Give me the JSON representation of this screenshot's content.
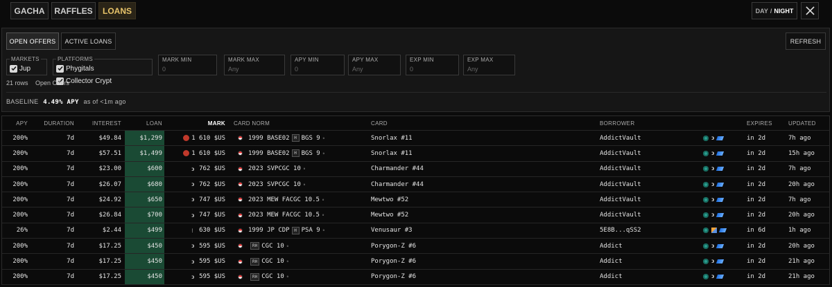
{
  "nav": {
    "tabs": [
      {
        "label": "GACHA",
        "active": false
      },
      {
        "label": "RAFFLES",
        "active": false
      },
      {
        "label": "LOANS",
        "active": true
      }
    ],
    "theme_day": "DAY",
    "theme_sep": "/",
    "theme_night": "NIGHT",
    "x_icon": "x-logo-icon"
  },
  "filters": {
    "view_tabs": [
      {
        "label": "OPEN OFFERS",
        "selected": true
      },
      {
        "label": "ACTIVE LOANS",
        "selected": false
      }
    ],
    "refresh_label": "REFRESH",
    "markets": {
      "legend": "MARKETS",
      "options": [
        {
          "label": "Jup",
          "checked": true
        }
      ]
    },
    "platforms": {
      "legend": "PLATFORMS",
      "options": [
        {
          "label": "Phygitals",
          "checked": true
        },
        {
          "label": "Collector Crypt",
          "checked": true
        }
      ]
    },
    "inputs": [
      {
        "label": "MARK MIN",
        "placeholder": "0"
      },
      {
        "label": "MARK MAX",
        "placeholder": "Any"
      },
      {
        "label": "APY MIN",
        "placeholder": "0"
      },
      {
        "label": "APY MAX",
        "placeholder": "Any"
      },
      {
        "label": "EXP MIN",
        "placeholder": "0"
      },
      {
        "label": "EXP MAX",
        "placeholder": "Any"
      }
    ],
    "rows_count": "21 rows",
    "scope": "Open Offers",
    "baseline_label": "BASELINE",
    "baseline_value": "4.49% APY",
    "baseline_asof": "as of <1m ago"
  },
  "table": {
    "headers": {
      "apy": "APY",
      "duration": "DURATION",
      "interest": "INTEREST",
      "loan": "LOAN",
      "mark": "MARK",
      "card_norm": "CARD NORM",
      "card": "CARD",
      "borrower": "BORROWER",
      "expires": "EXPIRES",
      "updated": "UPDATED"
    },
    "accent_loan_bg": "#1a4a34",
    "rows": [
      {
        "apy": "200%",
        "duration": "7d",
        "interest": "$49.84",
        "loan": "$1,299",
        "mark_icon": "red-coin-icon",
        "mark": "1 610 $US",
        "year_set": "1999 BASE02",
        "grade_badge": "H",
        "grade": "BGS 9",
        "card": "Snorlax #11",
        "borrower": "AddictVault",
        "platform_icons": [
          "teal",
          "hook",
          "blue"
        ],
        "expires": "in 2d",
        "updated": "7h ago"
      },
      {
        "apy": "200%",
        "duration": "7d",
        "interest": "$57.51",
        "loan": "$1,499",
        "mark_icon": "red-coin-icon",
        "mark": "1 610 $US",
        "year_set": "1999 BASE02",
        "grade_badge": "H",
        "grade": "BGS 9",
        "card": "Snorlax #11",
        "borrower": "AddictVault",
        "platform_icons": [
          "teal",
          "hook",
          "blue"
        ],
        "expires": "in 2d",
        "updated": "15h ago"
      },
      {
        "apy": "200%",
        "duration": "7d",
        "interest": "$23.00",
        "loan": "$600",
        "mark_icon": "hook-icon",
        "mark": "762 $US",
        "year_set": "2023 SVP",
        "grade_badge": "",
        "grade": "CGC 10",
        "card": "Charmander #44",
        "borrower": "AddictVault",
        "platform_icons": [
          "teal",
          "hook",
          "blue"
        ],
        "expires": "in 2d",
        "updated": "7h ago"
      },
      {
        "apy": "200%",
        "duration": "7d",
        "interest": "$26.07",
        "loan": "$680",
        "mark_icon": "hook-icon",
        "mark": "762 $US",
        "year_set": "2023 SVP",
        "grade_badge": "",
        "grade": "CGC 10",
        "card": "Charmander #44",
        "borrower": "AddictVault",
        "platform_icons": [
          "teal",
          "hook",
          "blue"
        ],
        "expires": "in 2d",
        "updated": "20h ago"
      },
      {
        "apy": "200%",
        "duration": "7d",
        "interest": "$24.92",
        "loan": "$650",
        "mark_icon": "hook-icon",
        "mark": "747 $US",
        "year_set": "2023 MEW FA",
        "grade_badge": "",
        "grade": "CGC 10.5",
        "card": "Mewtwo #52",
        "borrower": "AddictVault",
        "platform_icons": [
          "teal",
          "hook",
          "blue"
        ],
        "expires": "in 2d",
        "updated": "7h ago"
      },
      {
        "apy": "200%",
        "duration": "7d",
        "interest": "$26.84",
        "loan": "$700",
        "mark_icon": "hook-icon",
        "mark": "747 $US",
        "year_set": "2023 MEW FA",
        "grade_badge": "",
        "grade": "CGC 10.5",
        "card": "Mewtwo #52",
        "borrower": "AddictVault",
        "platform_icons": [
          "teal",
          "hook",
          "blue"
        ],
        "expires": "in 2d",
        "updated": "20h ago"
      },
      {
        "apy": "26%",
        "duration": "7d",
        "interest": "$2.44",
        "loan": "$499",
        "mark_icon": "tiny-icon",
        "mark": "630 $US",
        "year_set": "1999 JP CDP",
        "grade_badge": "H",
        "grade": "PSA 9",
        "card": "Venusaur #3",
        "borrower": "5E8B...qSS2",
        "platform_icons": [
          "teal",
          "cube",
          "blue"
        ],
        "expires": "in 6d",
        "updated": "1h ago"
      },
      {
        "apy": "200%",
        "duration": "7d",
        "interest": "$17.25",
        "loan": "$450",
        "mark_icon": "hook-icon",
        "mark": "595 $US",
        "year_set": "",
        "grade_badge": "RH",
        "grade": "CGC 10",
        "card": "Porygon-Z #6",
        "borrower": "Addict",
        "platform_icons": [
          "teal",
          "hook",
          "blue"
        ],
        "expires": "in 2d",
        "updated": "20h ago"
      },
      {
        "apy": "200%",
        "duration": "7d",
        "interest": "$17.25",
        "loan": "$450",
        "mark_icon": "hook-icon",
        "mark": "595 $US",
        "year_set": "",
        "grade_badge": "RH",
        "grade": "CGC 10",
        "card": "Porygon-Z #6",
        "borrower": "Addict",
        "platform_icons": [
          "teal",
          "hook",
          "blue"
        ],
        "expires": "in 2d",
        "updated": "21h ago"
      },
      {
        "apy": "200%",
        "duration": "7d",
        "interest": "$17.25",
        "loan": "$450",
        "mark_icon": "hook-icon",
        "mark": "595 $US",
        "year_set": "",
        "grade_badge": "RH",
        "grade": "CGC 10",
        "card": "Porygon-Z #6",
        "borrower": "Addict",
        "platform_icons": [
          "teal",
          "hook",
          "blue"
        ],
        "expires": "in 2d",
        "updated": "21h ago"
      }
    ]
  }
}
